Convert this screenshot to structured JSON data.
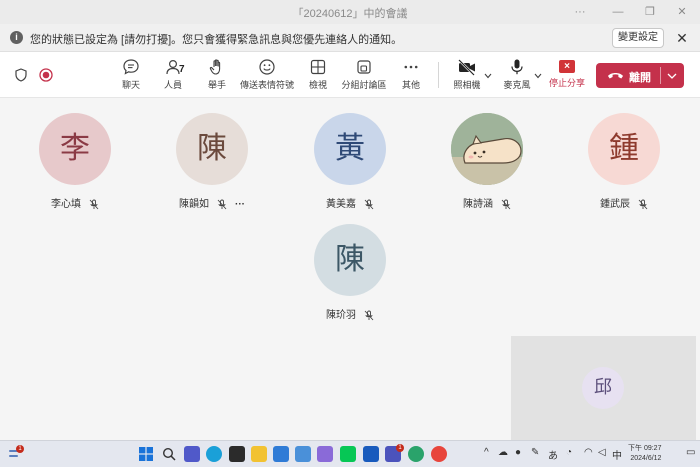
{
  "window": {
    "title": "「20240612」中的會議",
    "more": "···",
    "minimize": "—",
    "maximize": "❐",
    "close": "✕"
  },
  "notice": {
    "message": "您的狀態已設定為 [請勿打擾]。您只會獲得緊急訊息與您優先連絡人的通知。",
    "button": "變更設定",
    "close": "✕"
  },
  "toolbar": {
    "chat": "聊天",
    "people": "人員",
    "people_count": "7",
    "raise_hand": "舉手",
    "reactions": "傳送表情符號",
    "view": "檢視",
    "rooms": "分組討論區",
    "more": "其他",
    "camera": "照相機",
    "mic": "麥克風",
    "stop_share": "停止分享",
    "leave": "離開",
    "accent": "#c4314b"
  },
  "participants": [
    {
      "initial": "李",
      "name": "李心填",
      "bg": "#e7c9cb",
      "fg": "#8b3a45",
      "more": ""
    },
    {
      "initial": "陳",
      "name": "陳韻如",
      "bg": "#e6ddd8",
      "fg": "#6b4a3d",
      "more": "···"
    },
    {
      "initial": "黃",
      "name": "黃美嘉",
      "bg": "#c9d6ea",
      "fg": "#2f4a77",
      "more": ""
    },
    {
      "initial": "",
      "name": "陳詩涵",
      "bg": "#a8b89a",
      "fg": "#333333",
      "more": ""
    },
    {
      "initial": "鍾",
      "name": "鍾武辰",
      "bg": "#f7d9d4",
      "fg": "#8e3a2d",
      "more": ""
    },
    {
      "initial": "陳",
      "name": "陳玠羽",
      "bg": "#d3dde2",
      "fg": "#3c5766",
      "more": ""
    }
  ],
  "self": {
    "initial": "邱"
  },
  "taskbar": {
    "time": "下午 09:27",
    "date": "2024/6/12",
    "ime": "あ",
    "lang": "中",
    "notif_badge": "1",
    "mail_badge": "1"
  }
}
